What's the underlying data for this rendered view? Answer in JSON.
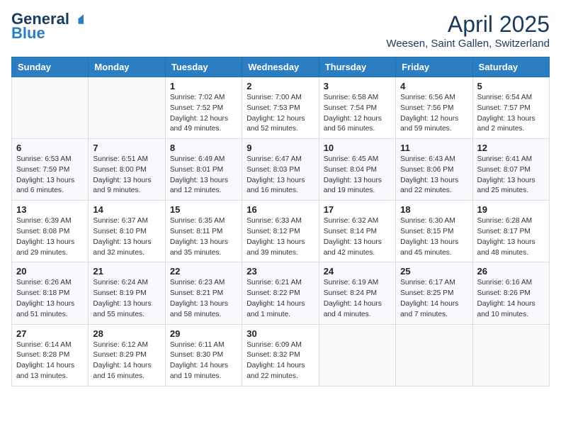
{
  "header": {
    "logo_general": "General",
    "logo_blue": "Blue",
    "month_title": "April 2025",
    "location": "Weesen, Saint Gallen, Switzerland"
  },
  "weekdays": [
    "Sunday",
    "Monday",
    "Tuesday",
    "Wednesday",
    "Thursday",
    "Friday",
    "Saturday"
  ],
  "weeks": [
    [
      {
        "day": "",
        "info": ""
      },
      {
        "day": "",
        "info": ""
      },
      {
        "day": "1",
        "info": "Sunrise: 7:02 AM\nSunset: 7:52 PM\nDaylight: 12 hours and 49 minutes."
      },
      {
        "day": "2",
        "info": "Sunrise: 7:00 AM\nSunset: 7:53 PM\nDaylight: 12 hours and 52 minutes."
      },
      {
        "day": "3",
        "info": "Sunrise: 6:58 AM\nSunset: 7:54 PM\nDaylight: 12 hours and 56 minutes."
      },
      {
        "day": "4",
        "info": "Sunrise: 6:56 AM\nSunset: 7:56 PM\nDaylight: 12 hours and 59 minutes."
      },
      {
        "day": "5",
        "info": "Sunrise: 6:54 AM\nSunset: 7:57 PM\nDaylight: 13 hours and 2 minutes."
      }
    ],
    [
      {
        "day": "6",
        "info": "Sunrise: 6:53 AM\nSunset: 7:59 PM\nDaylight: 13 hours and 6 minutes."
      },
      {
        "day": "7",
        "info": "Sunrise: 6:51 AM\nSunset: 8:00 PM\nDaylight: 13 hours and 9 minutes."
      },
      {
        "day": "8",
        "info": "Sunrise: 6:49 AM\nSunset: 8:01 PM\nDaylight: 13 hours and 12 minutes."
      },
      {
        "day": "9",
        "info": "Sunrise: 6:47 AM\nSunset: 8:03 PM\nDaylight: 13 hours and 16 minutes."
      },
      {
        "day": "10",
        "info": "Sunrise: 6:45 AM\nSunset: 8:04 PM\nDaylight: 13 hours and 19 minutes."
      },
      {
        "day": "11",
        "info": "Sunrise: 6:43 AM\nSunset: 8:06 PM\nDaylight: 13 hours and 22 minutes."
      },
      {
        "day": "12",
        "info": "Sunrise: 6:41 AM\nSunset: 8:07 PM\nDaylight: 13 hours and 25 minutes."
      }
    ],
    [
      {
        "day": "13",
        "info": "Sunrise: 6:39 AM\nSunset: 8:08 PM\nDaylight: 13 hours and 29 minutes."
      },
      {
        "day": "14",
        "info": "Sunrise: 6:37 AM\nSunset: 8:10 PM\nDaylight: 13 hours and 32 minutes."
      },
      {
        "day": "15",
        "info": "Sunrise: 6:35 AM\nSunset: 8:11 PM\nDaylight: 13 hours and 35 minutes."
      },
      {
        "day": "16",
        "info": "Sunrise: 6:33 AM\nSunset: 8:12 PM\nDaylight: 13 hours and 39 minutes."
      },
      {
        "day": "17",
        "info": "Sunrise: 6:32 AM\nSunset: 8:14 PM\nDaylight: 13 hours and 42 minutes."
      },
      {
        "day": "18",
        "info": "Sunrise: 6:30 AM\nSunset: 8:15 PM\nDaylight: 13 hours and 45 minutes."
      },
      {
        "day": "19",
        "info": "Sunrise: 6:28 AM\nSunset: 8:17 PM\nDaylight: 13 hours and 48 minutes."
      }
    ],
    [
      {
        "day": "20",
        "info": "Sunrise: 6:26 AM\nSunset: 8:18 PM\nDaylight: 13 hours and 51 minutes."
      },
      {
        "day": "21",
        "info": "Sunrise: 6:24 AM\nSunset: 8:19 PM\nDaylight: 13 hours and 55 minutes."
      },
      {
        "day": "22",
        "info": "Sunrise: 6:23 AM\nSunset: 8:21 PM\nDaylight: 13 hours and 58 minutes."
      },
      {
        "day": "23",
        "info": "Sunrise: 6:21 AM\nSunset: 8:22 PM\nDaylight: 14 hours and 1 minute."
      },
      {
        "day": "24",
        "info": "Sunrise: 6:19 AM\nSunset: 8:24 PM\nDaylight: 14 hours and 4 minutes."
      },
      {
        "day": "25",
        "info": "Sunrise: 6:17 AM\nSunset: 8:25 PM\nDaylight: 14 hours and 7 minutes."
      },
      {
        "day": "26",
        "info": "Sunrise: 6:16 AM\nSunset: 8:26 PM\nDaylight: 14 hours and 10 minutes."
      }
    ],
    [
      {
        "day": "27",
        "info": "Sunrise: 6:14 AM\nSunset: 8:28 PM\nDaylight: 14 hours and 13 minutes."
      },
      {
        "day": "28",
        "info": "Sunrise: 6:12 AM\nSunset: 8:29 PM\nDaylight: 14 hours and 16 minutes."
      },
      {
        "day": "29",
        "info": "Sunrise: 6:11 AM\nSunset: 8:30 PM\nDaylight: 14 hours and 19 minutes."
      },
      {
        "day": "30",
        "info": "Sunrise: 6:09 AM\nSunset: 8:32 PM\nDaylight: 14 hours and 22 minutes."
      },
      {
        "day": "",
        "info": ""
      },
      {
        "day": "",
        "info": ""
      },
      {
        "day": "",
        "info": ""
      }
    ]
  ]
}
